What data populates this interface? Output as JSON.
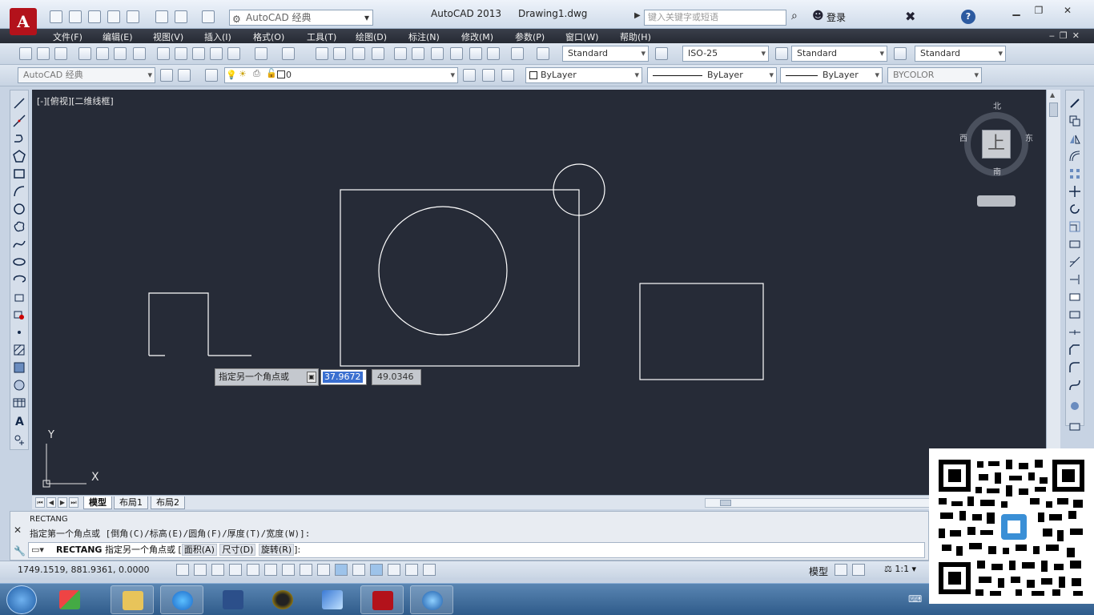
{
  "titlebar": {
    "workspace": "AutoCAD 经典",
    "app_title": "AutoCAD 2013",
    "doc_title": "Drawing1.dwg",
    "search_placeholder": "键入关键字或短语",
    "login": "登录"
  },
  "menu": {
    "items": [
      "文件(F)",
      "编辑(E)",
      "视图(V)",
      "插入(I)",
      "格式(O)",
      "工具(T)",
      "绘图(D)",
      "标注(N)",
      "修改(M)",
      "参数(P)",
      "窗口(W)",
      "帮助(H)"
    ]
  },
  "toolbar1": {
    "text_style": "Standard",
    "dim_style": "ISO-25",
    "table_style": "Standard",
    "mleader_style": "Standard"
  },
  "toolbar2": {
    "workspace_combo": "AutoCAD 经典",
    "layer": "0",
    "color": "ByLayer",
    "linetype": "ByLayer",
    "lineweight": "ByLayer",
    "plotstyle": "BYCOLOR"
  },
  "viewport": {
    "label": "[-][俯视][二维线框]"
  },
  "viewcube": {
    "north": "北",
    "south": "南",
    "east": "东",
    "west": "西",
    "face": "上"
  },
  "ucs": {
    "x": "X",
    "y": "Y"
  },
  "dynamic_input": {
    "prompt": "指定另一个角点或",
    "value1": "37.9672",
    "value2": "49.0346"
  },
  "layout_tabs": [
    "模型",
    "布局1",
    "布局2"
  ],
  "command": {
    "history1": "RECTANG",
    "history2": "指定第一个角点或 [倒角(C)/标高(E)/圆角(F)/厚度(T)/宽度(W)]:",
    "current_cmd": "RECTANG",
    "current_prompt": "指定另一个角点或",
    "options": [
      "面积(A)",
      "尺寸(D)",
      "旋转(R)"
    ],
    "suffix": "]:"
  },
  "statusbar": {
    "coords": "1749.1519, 881.9361, 0.0000",
    "model": "模型",
    "scale": "1:1"
  },
  "colors": {
    "canvas": "#262b37",
    "geometry": "#ffffff",
    "accent": "#3a6fd0"
  }
}
